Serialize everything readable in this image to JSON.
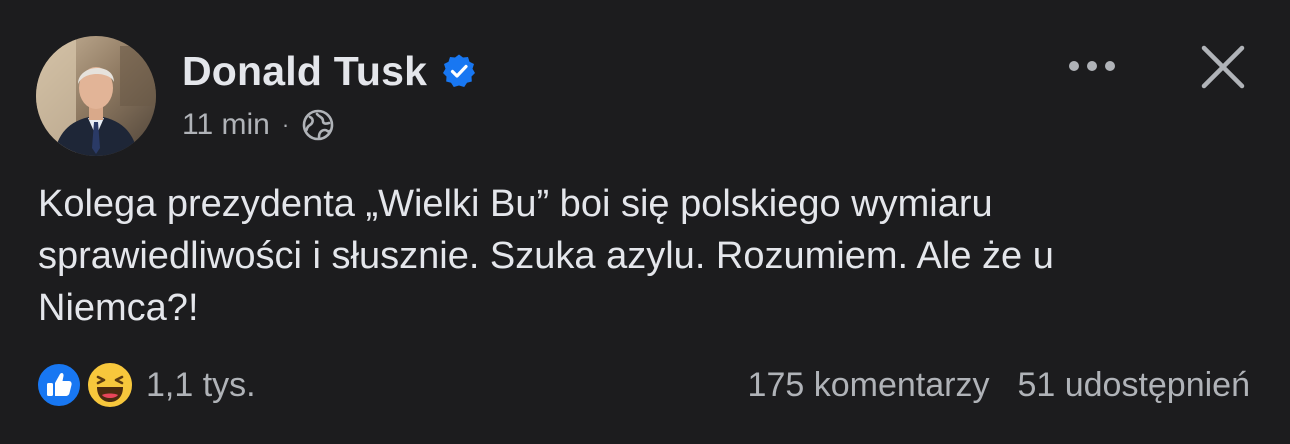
{
  "post": {
    "author": "Donald Tusk",
    "verified": true,
    "time": "11 min",
    "separator": "·",
    "visibility_icon": "globe-icon",
    "text": "Kolega prezydenta „Wielki Bu” boi się polskiego wymiaru\nsprawiedliwości i słusznie. Szuka azylu. Rozumiem. Ale że u\nNiemca?!",
    "more_icon": "more-options-icon",
    "close_icon": "close-icon"
  },
  "footer": {
    "reaction_icons": [
      "like-icon",
      "haha-icon"
    ],
    "reaction_count": "1,1 tys.",
    "comments": "175 komentarzy",
    "shares": "51 udostępnień"
  },
  "colors": {
    "background": "#1c1c1e",
    "text_primary": "#e4e6eb",
    "text_secondary": "#b0b3b8",
    "verified_blue": "#1877f2",
    "like_blue": "#1877f2",
    "haha_yellow": "#f7c73c"
  }
}
